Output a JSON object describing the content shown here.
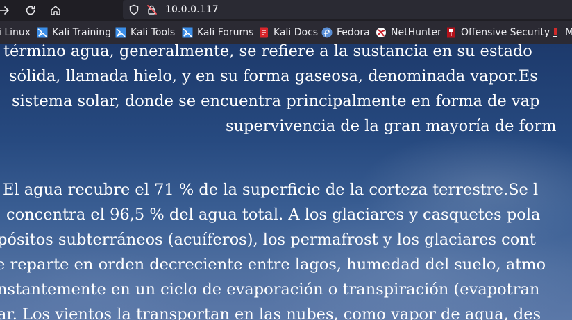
{
  "browser": {
    "url": "10.0.0.117"
  },
  "bookmarks": [
    {
      "label": "i Linux",
      "icon": "kali-dragon-icon"
    },
    {
      "label": "Kali Training",
      "icon": "kali-training-icon"
    },
    {
      "label": "Kali Tools",
      "icon": "kali-tools-icon"
    },
    {
      "label": "Kali Forums",
      "icon": "kali-forums-icon"
    },
    {
      "label": "Kali Docs",
      "icon": "kali-docs-icon"
    },
    {
      "label": "Fedora",
      "icon": "fedora-icon"
    },
    {
      "label": "NetHunter",
      "icon": "nethunter-icon"
    },
    {
      "label": "Offensive Security",
      "icon": "offsec-icon"
    },
    {
      "label": "M",
      "icon": "exploit-db-icon"
    }
  ],
  "content": {
    "paragraph1": [
      "término agua, generalmente, se refiere a la sustancia en su estado",
      "sólida, llamada hielo, y en su forma gaseosa, denominada vapor.Es",
      "sistema solar, donde se encuentra principalmente en forma de vap",
      "supervivencia de la gran mayoría de form"
    ],
    "paragraph2": [
      "El agua recubre el 71 % de la superficie de la corteza terrestre.Se l",
      "concentra el 96,5 % del agua total. A los glaciares y casquetes pola",
      "pósitos subterráneos (acuíferos), los permafrost y los glaciares cont",
      "e reparte en orden decreciente entre lagos, humedad del suelo, atmo",
      "nstantemente en un ciclo de evaporación o transpiración (evapotran",
      "ar. Los vientos la transportan en las nubes, como vapor de agua, des"
    ]
  }
}
